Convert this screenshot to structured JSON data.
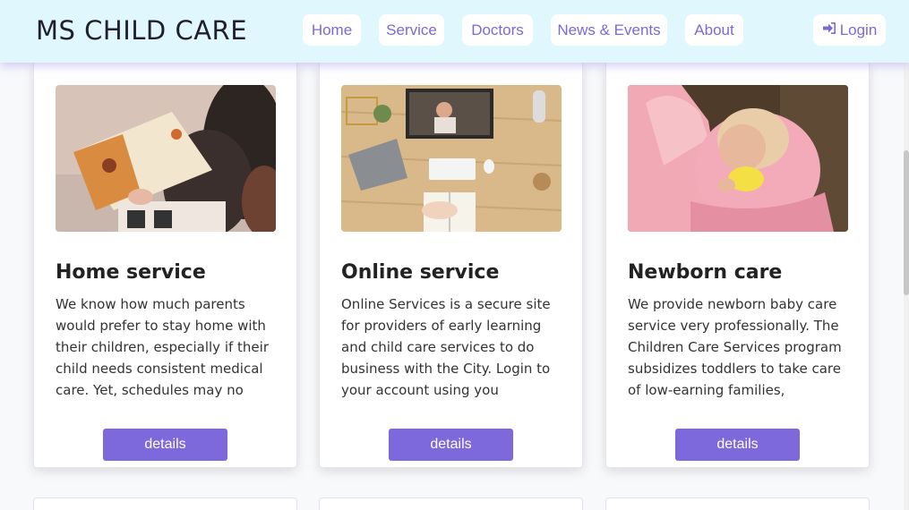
{
  "brand": "MS CHILD CARE",
  "nav": {
    "home": "Home",
    "service": "Service",
    "doctors": "Doctors",
    "news": "News & Events",
    "about": "About",
    "login": "Login"
  },
  "colors": {
    "navbar_bg": "#e0f8fd",
    "accent": "#7d68dc"
  },
  "cards": [
    {
      "title": "Home service",
      "text": "We know how much parents would prefer to stay home with their children, especially if their child needs consistent medical care. Yet, schedules may no",
      "button": "details",
      "image_icon": "parent-reading-book-to-child"
    },
    {
      "title": "Online service",
      "text": "Online Services is a secure site for providers of early learning and child care services to do business with the City. Login to your account using you",
      "button": "details",
      "image_icon": "desk-with-video-call-monitor"
    },
    {
      "title": "Newborn care",
      "text": "We provide newborn baby care service very professionally. The Children Care Services program subsidizes toddlers to take care of low-earning families,",
      "button": "details",
      "image_icon": "mother-holding-newborn"
    }
  ]
}
